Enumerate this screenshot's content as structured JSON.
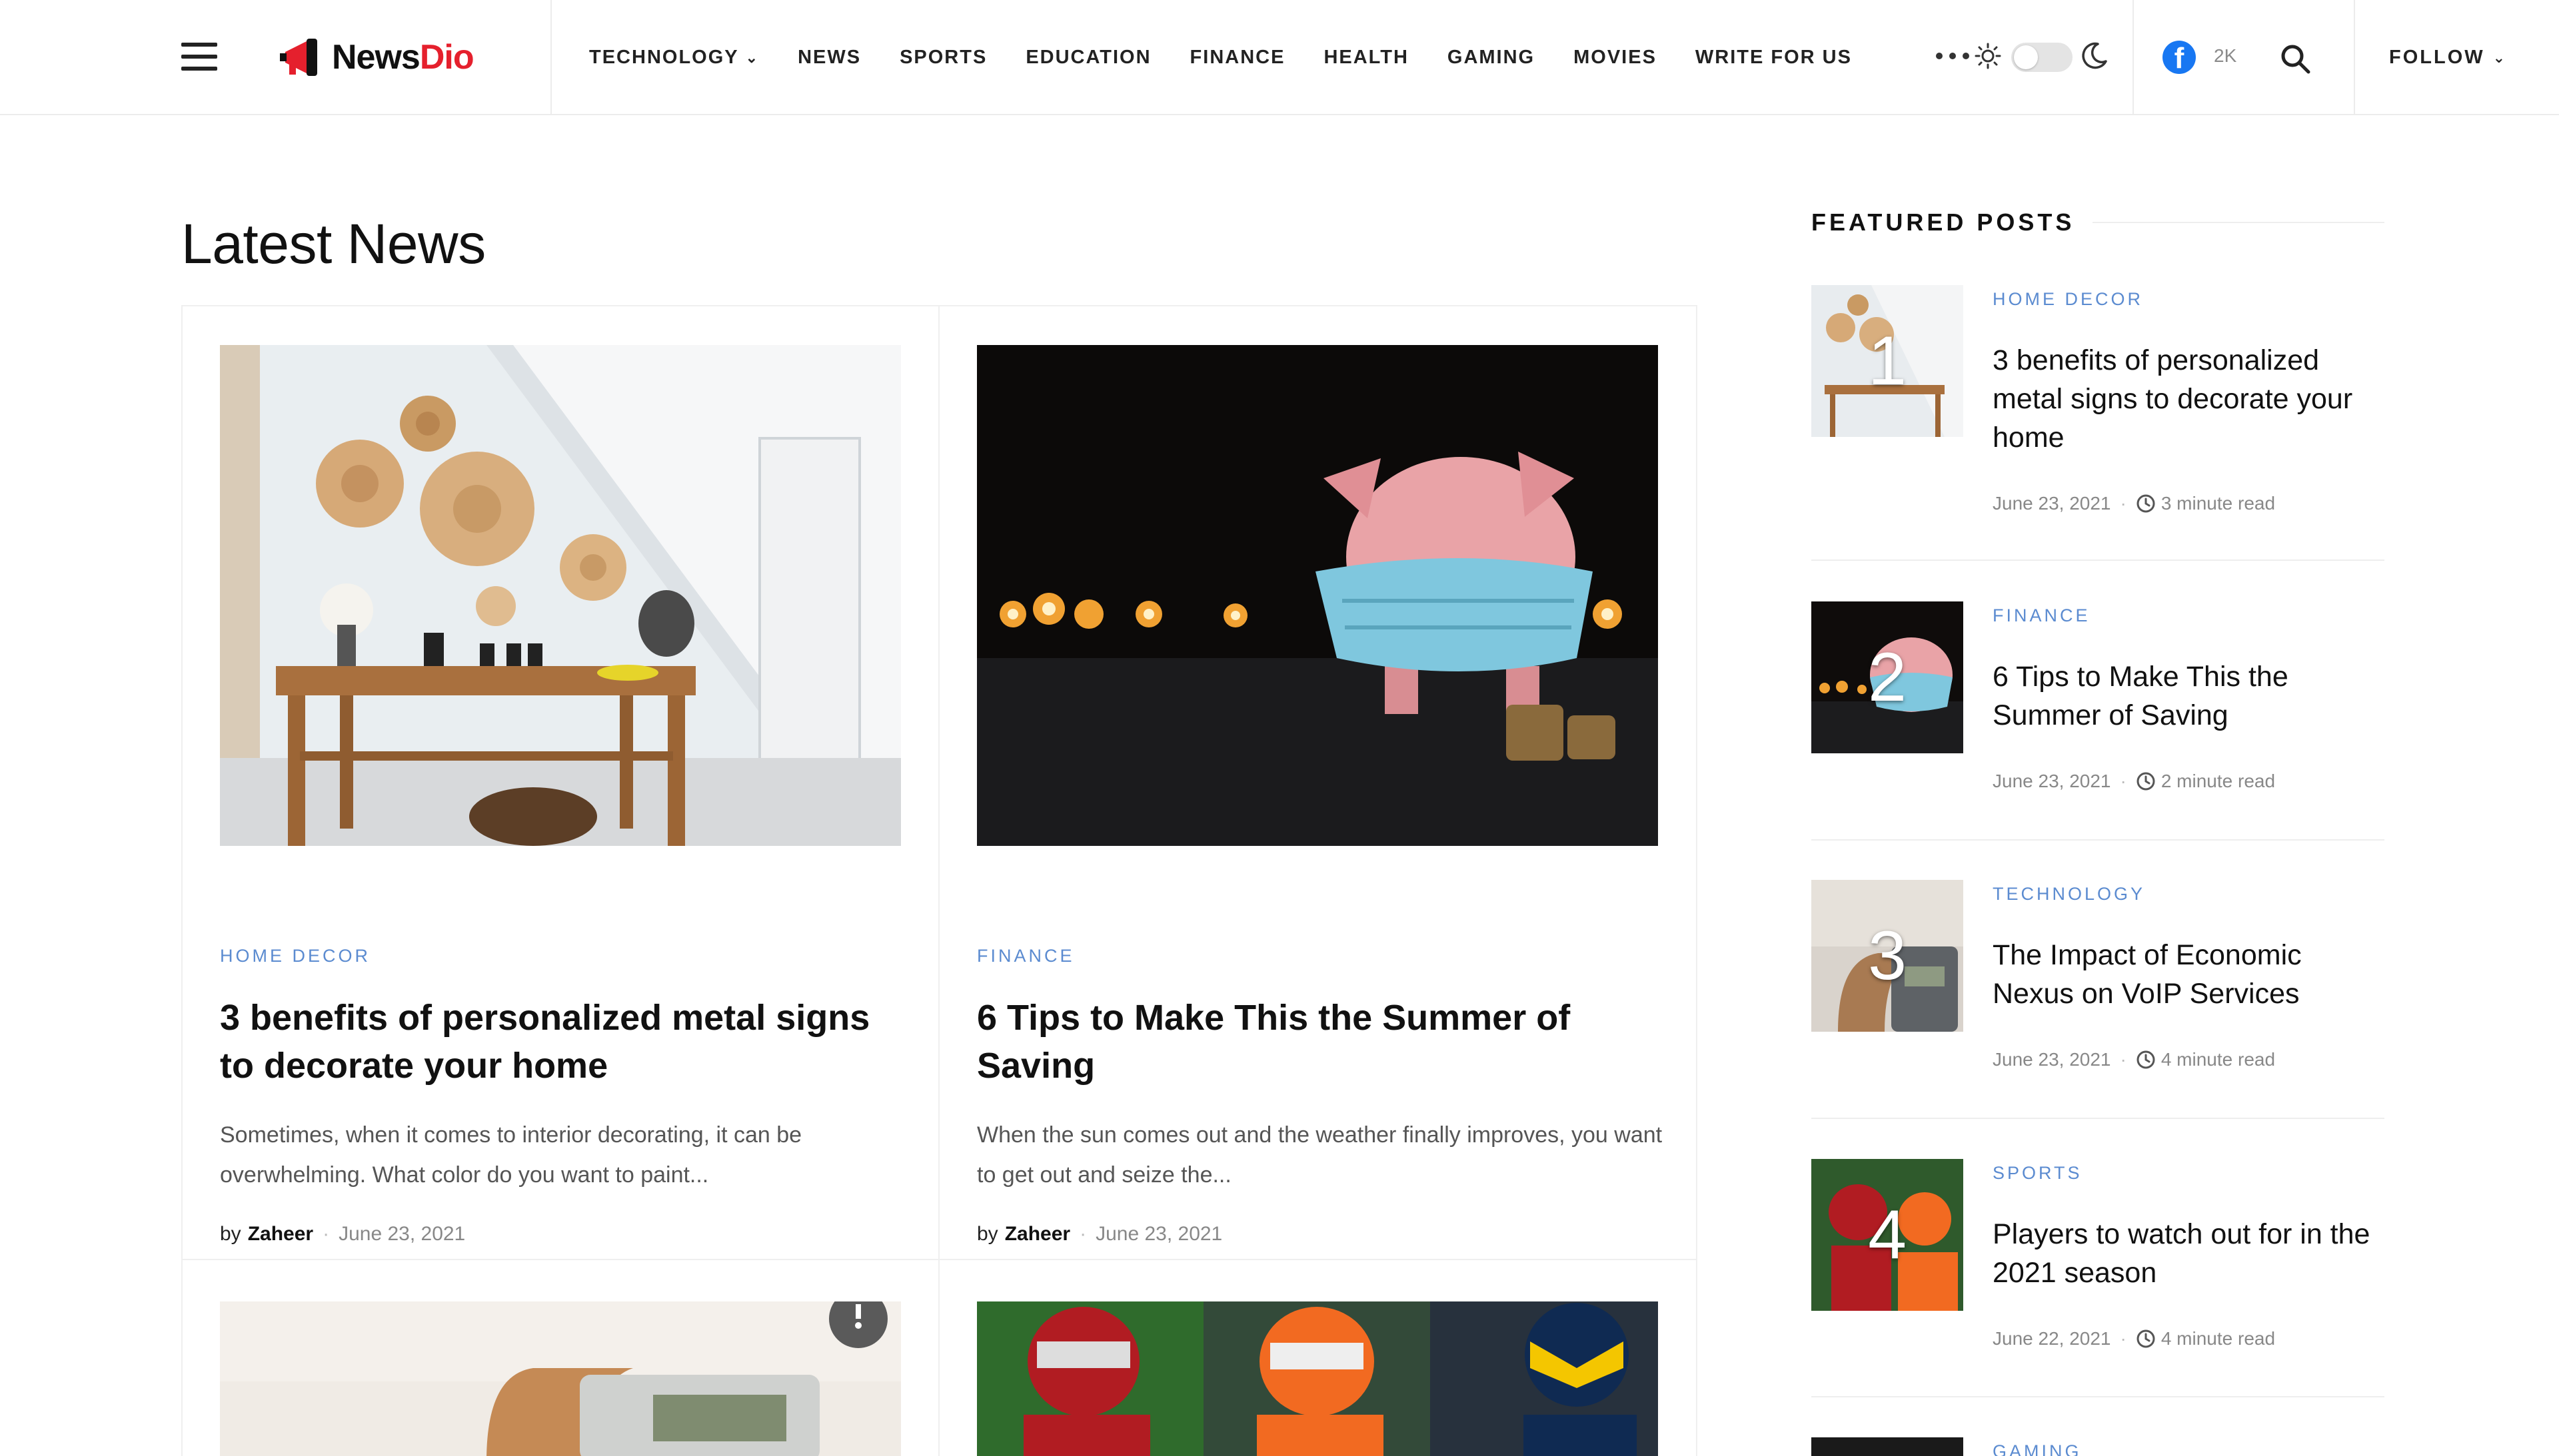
{
  "header": {
    "logo": {
      "part1": "News",
      "part2": "Dio"
    },
    "nav": [
      {
        "label": "TECHNOLOGY",
        "has_dropdown": true
      },
      {
        "label": "NEWS"
      },
      {
        "label": "SPORTS"
      },
      {
        "label": "EDUCATION"
      },
      {
        "label": "FINANCE"
      },
      {
        "label": "HEALTH"
      },
      {
        "label": "GAMING"
      },
      {
        "label": "MOVIES"
      },
      {
        "label": "WRITE FOR US"
      }
    ],
    "facebook_count": "2K",
    "follow_label": "FOLLOW",
    "icons": [
      "menu-icon",
      "more-dots-icon",
      "sun-icon",
      "moon-icon",
      "facebook-icon",
      "search-icon",
      "chevron-down-icon",
      "clock-icon"
    ]
  },
  "main": {
    "section_title": "Latest News",
    "cards": [
      {
        "category": "HOME DECOR",
        "title": "3 benefits of personalized metal signs to decorate your home",
        "excerpt": "Sometimes, when it comes to interior decorating, it can be overwhelming. What color do you want to paint...",
        "by": "by",
        "author": "Zaheer",
        "date": "June 23, 2021"
      },
      {
        "category": "FINANCE",
        "title": "6 Tips to Make This the Summer of Saving",
        "excerpt": "When the sun comes out and the weather finally improves, you want to get out and seize the...",
        "by": "by",
        "author": "Zaheer",
        "date": "June 23, 2021"
      }
    ]
  },
  "sidebar": {
    "heading": "FEATURED POSTS",
    "posts": [
      {
        "num": "1",
        "category": "HOME DECOR",
        "title": "3 benefits of personalized metal signs to decorate your home",
        "date": "June 23, 2021",
        "read": "3 minute read"
      },
      {
        "num": "2",
        "category": "FINANCE",
        "title": "6 Tips to Make This the Summer of Saving",
        "date": "June 23, 2021",
        "read": "2 minute read"
      },
      {
        "num": "3",
        "category": "TECHNOLOGY",
        "title": "The Impact of Economic Nexus on VoIP Services",
        "date": "June 23, 2021",
        "read": "4 minute read"
      },
      {
        "num": "4",
        "category": "SPORTS",
        "title": "Players to watch out for in the 2021 season",
        "date": "June 22, 2021",
        "read": "4 minute read"
      },
      {
        "category": "GAMING"
      }
    ]
  },
  "colors": {
    "accent_red": "#e5202d",
    "category_blue": "#5b8bd0",
    "facebook_blue": "#1877f2"
  }
}
